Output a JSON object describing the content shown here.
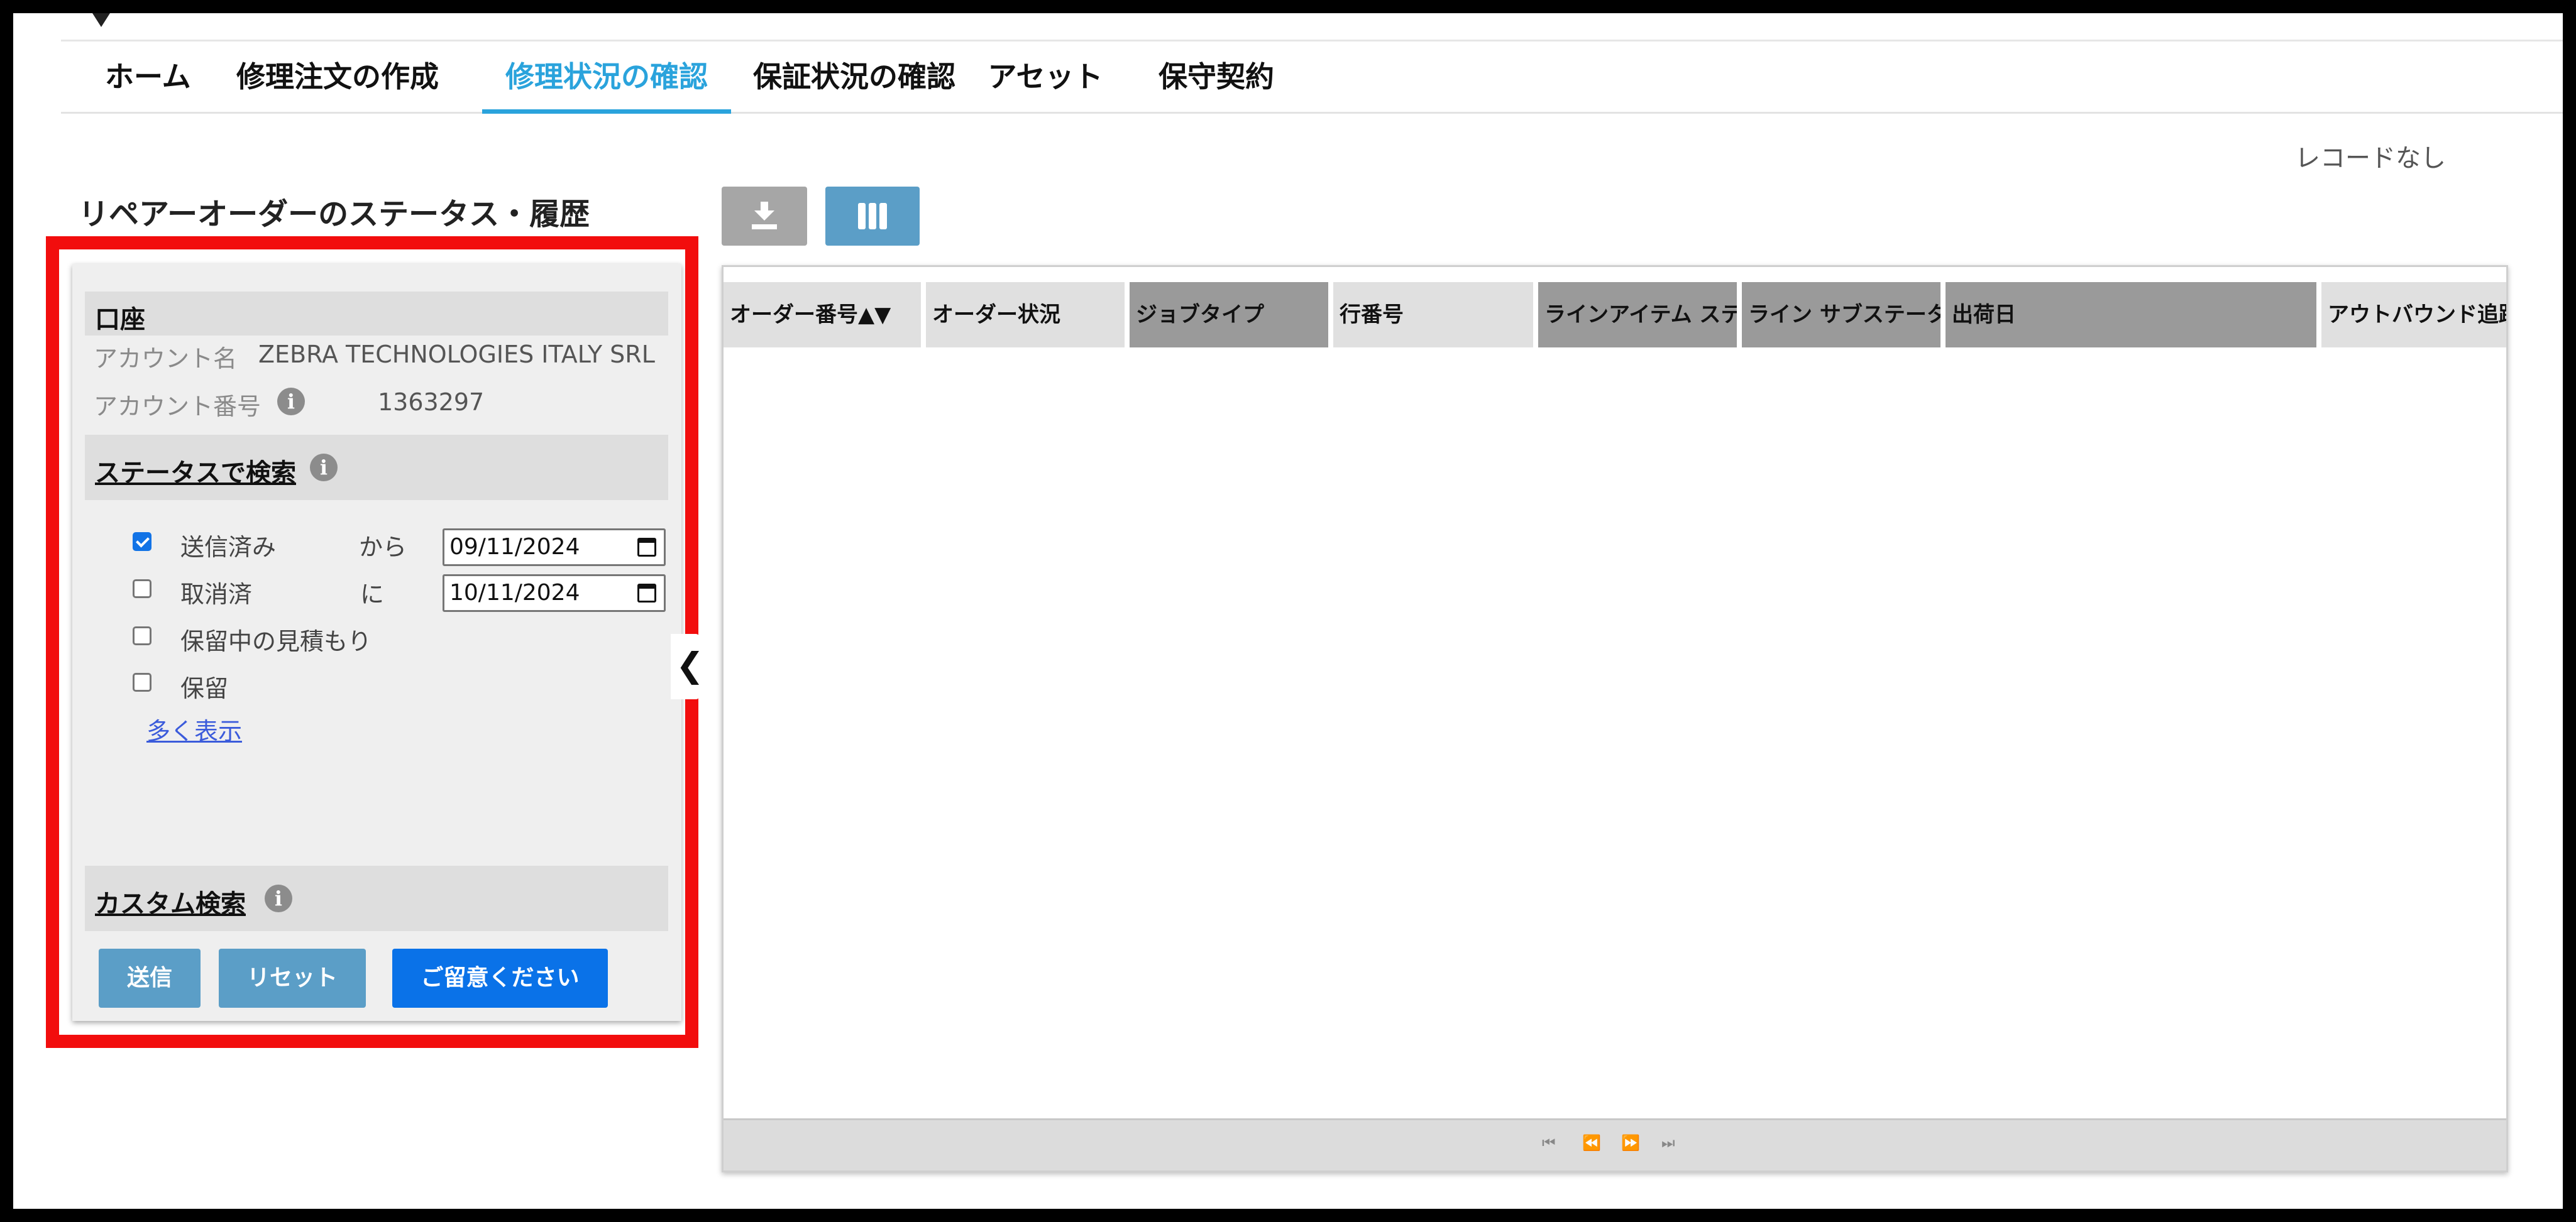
{
  "nav": {
    "items": [
      "ホーム",
      "修理注文の作成",
      "修理状況の確認",
      "保証状況の確認",
      "アセット",
      "保守契約"
    ],
    "active_index": 2,
    "active_color": "#2aa3dc"
  },
  "records_status": "レコードなし",
  "page_title": "リペアーオーダーのステータス・履歴",
  "account": {
    "section_title": "口座",
    "name_label": "アカウント名",
    "name_value": "ZEBRA TECHNOLOGIES ITALY SRL",
    "number_label": "アカウント番号",
    "number_value": "1363297"
  },
  "status_search": {
    "title": "ステータスで検索",
    "options": [
      {
        "label": "送信済み",
        "checked": true
      },
      {
        "label": "取消済",
        "checked": false
      },
      {
        "label": "保留中の見積もり",
        "checked": false
      },
      {
        "label": "保留",
        "checked": false
      }
    ],
    "from_label": "から",
    "from_date": "09/11/2024",
    "to_label": "に",
    "to_date": "10/11/2024",
    "show_more": "多く表示"
  },
  "custom_search": {
    "title": "カスタム検索"
  },
  "buttons": {
    "submit": "送信",
    "reset": "リセット",
    "hold": "ご留意ください"
  },
  "toolbar": {
    "download_icon": "download-icon",
    "columns_icon": "columns-icon"
  },
  "grid": {
    "columns": [
      "オーダー番号▲▼",
      "オーダー状況",
      "ジョブタイプ",
      "行番号",
      "ラインアイテム ステ",
      "ライン サブステータ",
      "出荷日",
      "アウトバウンド追跡"
    ],
    "rows": [],
    "pager": [
      "⏮",
      "⏪",
      "⏩",
      "⏭"
    ]
  },
  "colors": {
    "highlight": "#f20d0d",
    "primary_button": "#0a72e8",
    "secondary_button": "#5b9ec7"
  }
}
